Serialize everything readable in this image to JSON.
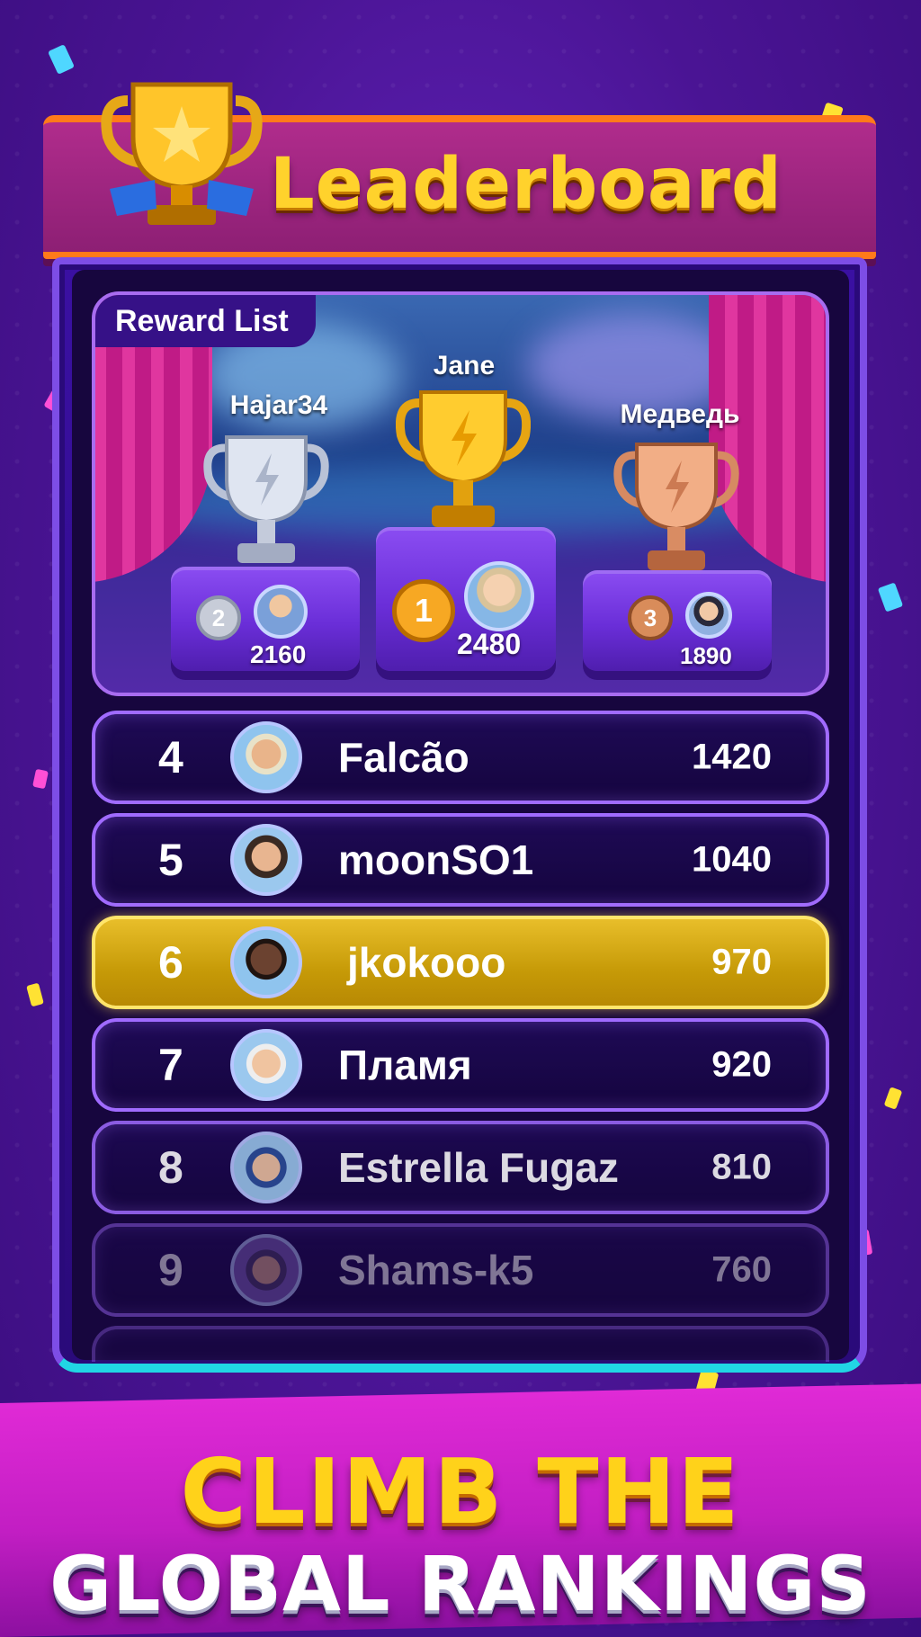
{
  "header": {
    "title": "Leaderboard",
    "icon": "trophy-icon"
  },
  "podium": {
    "tab_label": "Reward List",
    "first": {
      "name": "Jane",
      "score": "2480",
      "medal": "1",
      "trophy": "gold"
    },
    "second": {
      "name": "Hajar34",
      "score": "2160",
      "medal": "2",
      "trophy": "silver"
    },
    "third": {
      "name": "Медведь",
      "score": "1890",
      "medal": "3",
      "trophy": "bronze"
    }
  },
  "rows": [
    {
      "rank": "4",
      "name": "Falcão",
      "score": "1420"
    },
    {
      "rank": "5",
      "name": "moonSO1",
      "score": "1040"
    },
    {
      "rank": "6",
      "name": "jkokooo",
      "score": "970",
      "highlight": true
    },
    {
      "rank": "7",
      "name": "Пламя",
      "score": "920"
    },
    {
      "rank": "8",
      "name": "Estrella Fugaz",
      "score": "810"
    },
    {
      "rank": "9",
      "name": "Shams-k5",
      "score": "760"
    }
  ],
  "cta": {
    "line1": "CLIMB THE",
    "line2": "GLOBAL RANKINGS"
  },
  "colors": {
    "accent_gold": "#ffd22c",
    "panel_purple": "#3a10a2",
    "highlight_row": "#e8be2a",
    "border_cyan": "#21d6e4"
  }
}
